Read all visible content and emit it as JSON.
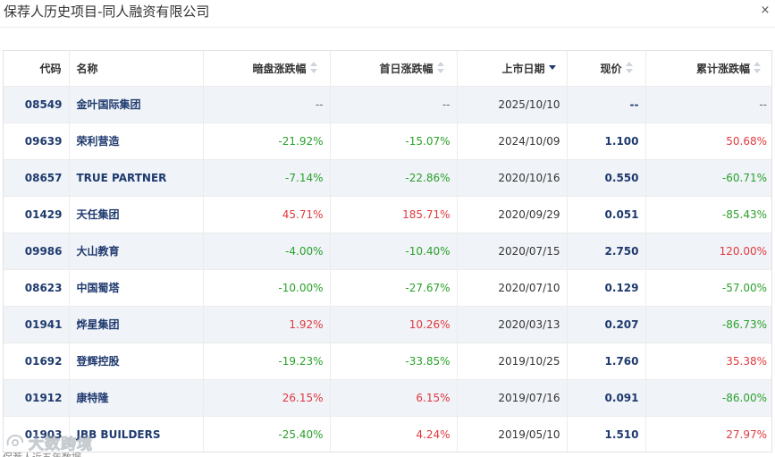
{
  "dialog": {
    "title": "保荐人历史项目-同人融资有限公司",
    "close_glyph": "×"
  },
  "table": {
    "columns": {
      "code": "代码",
      "name": "名称",
      "dark_change": "暗盘涨跌幅",
      "first_day_change": "首日涨跌幅",
      "listing_date": "上市日期",
      "price": "现价",
      "cum_change": "累计涨跌幅"
    },
    "sorted_by": "listing_date",
    "sort_direction": "desc",
    "rows": [
      {
        "code": "08549",
        "name": "金叶国际集团",
        "dark": "--",
        "first": "--",
        "date": "2025/10/10",
        "price": "--",
        "cum": "--",
        "dark_sign": "flat",
        "first_sign": "flat",
        "cum_sign": "flat"
      },
      {
        "code": "09639",
        "name": "荣利营造",
        "dark": "-21.92%",
        "first": "-15.07%",
        "date": "2024/10/09",
        "price": "1.100",
        "cum": "50.68%",
        "dark_sign": "neg",
        "first_sign": "neg",
        "cum_sign": "pos"
      },
      {
        "code": "08657",
        "name": "TRUE PARTNER",
        "dark": "-7.14%",
        "first": "-22.86%",
        "date": "2020/10/16",
        "price": "0.550",
        "cum": "-60.71%",
        "dark_sign": "neg",
        "first_sign": "neg",
        "cum_sign": "neg"
      },
      {
        "code": "01429",
        "name": "天任集团",
        "dark": "45.71%",
        "first": "185.71%",
        "date": "2020/09/29",
        "price": "0.051",
        "cum": "-85.43%",
        "dark_sign": "pos",
        "first_sign": "pos",
        "cum_sign": "neg"
      },
      {
        "code": "09986",
        "name": "大山教育",
        "dark": "-4.00%",
        "first": "-10.40%",
        "date": "2020/07/15",
        "price": "2.750",
        "cum": "120.00%",
        "dark_sign": "neg",
        "first_sign": "neg",
        "cum_sign": "pos"
      },
      {
        "code": "08623",
        "name": "中国蜀塔",
        "dark": "-10.00%",
        "first": "-27.67%",
        "date": "2020/07/10",
        "price": "0.129",
        "cum": "-57.00%",
        "dark_sign": "neg",
        "first_sign": "neg",
        "cum_sign": "neg"
      },
      {
        "code": "01941",
        "name": "烨星集团",
        "dark": "1.92%",
        "first": "10.26%",
        "date": "2020/03/13",
        "price": "0.207",
        "cum": "-86.73%",
        "dark_sign": "pos",
        "first_sign": "pos",
        "cum_sign": "neg"
      },
      {
        "code": "01692",
        "name": "登辉控股",
        "dark": "-19.23%",
        "first": "-33.85%",
        "date": "2019/10/25",
        "price": "1.760",
        "cum": "35.38%",
        "dark_sign": "neg",
        "first_sign": "neg",
        "cum_sign": "pos"
      },
      {
        "code": "01912",
        "name": "康特隆",
        "dark": "26.15%",
        "first": "6.15%",
        "date": "2019/07/16",
        "price": "0.091",
        "cum": "-86.00%",
        "dark_sign": "pos",
        "first_sign": "pos",
        "cum_sign": "neg"
      },
      {
        "code": "01903",
        "name": "JBB BUILDERS",
        "dark": "-25.40%",
        "first": "4.24%",
        "date": "2019/05/10",
        "price": "1.510",
        "cum": "27.97%",
        "dark_sign": "neg",
        "first_sign": "pos",
        "cum_sign": "pos"
      }
    ]
  },
  "footnote": "保荐人近五年数据",
  "watermark": {
    "text": "大数跨境",
    "icon": "watermark-logo-icon"
  },
  "colors": {
    "positive": "#e0393e",
    "negative": "#2aa12a",
    "link": "#1f3a6e",
    "stripe": "#f0f3f8"
  }
}
